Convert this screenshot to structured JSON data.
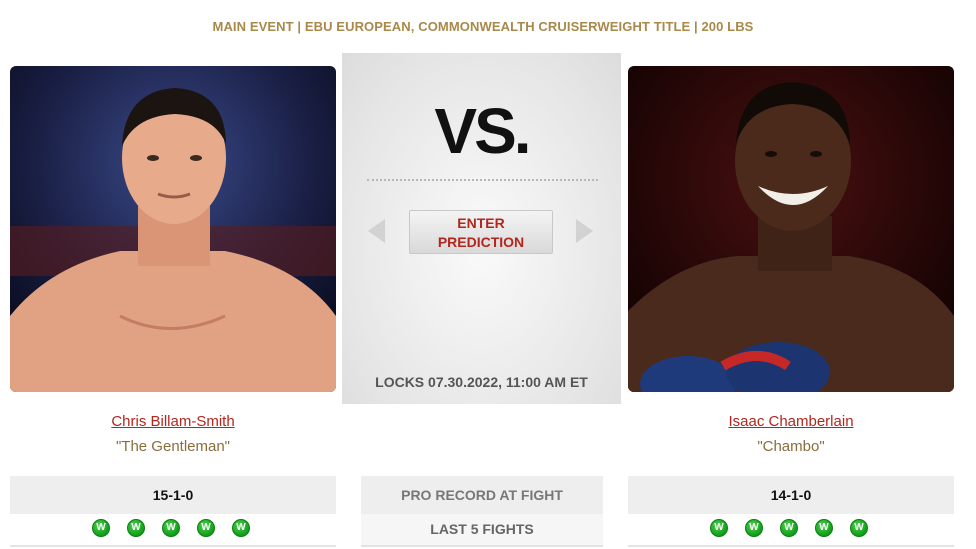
{
  "event": {
    "title": "MAIN EVENT | EBU EUROPEAN, COMMONWEALTH CRUISERWEIGHT TITLE | 200 LBS"
  },
  "center": {
    "vs_text": "VS.",
    "predict_button_line1": "ENTER",
    "predict_button_line2": "PREDICTION",
    "locks_text": "LOCKS 07.30.2022, 11:00 AM ET",
    "record_label": "PRO RECORD AT FIGHT",
    "last5_label": "LAST 5 FIGHTS"
  },
  "fighters": [
    {
      "name": "Chris Billam-Smith",
      "nickname": "\"The Gentleman\"",
      "record": "15-1-0",
      "last5": [
        "W",
        "W",
        "W",
        "W",
        "W"
      ]
    },
    {
      "name": "Isaac Chamberlain",
      "nickname": "\"Chambo\"",
      "record": "14-1-0",
      "last5": [
        "W",
        "W",
        "W",
        "W",
        "W"
      ]
    }
  ],
  "colors": {
    "accent_gold": "#a8894a",
    "link_red": "#b3261e",
    "win_green": "#119d1a"
  }
}
